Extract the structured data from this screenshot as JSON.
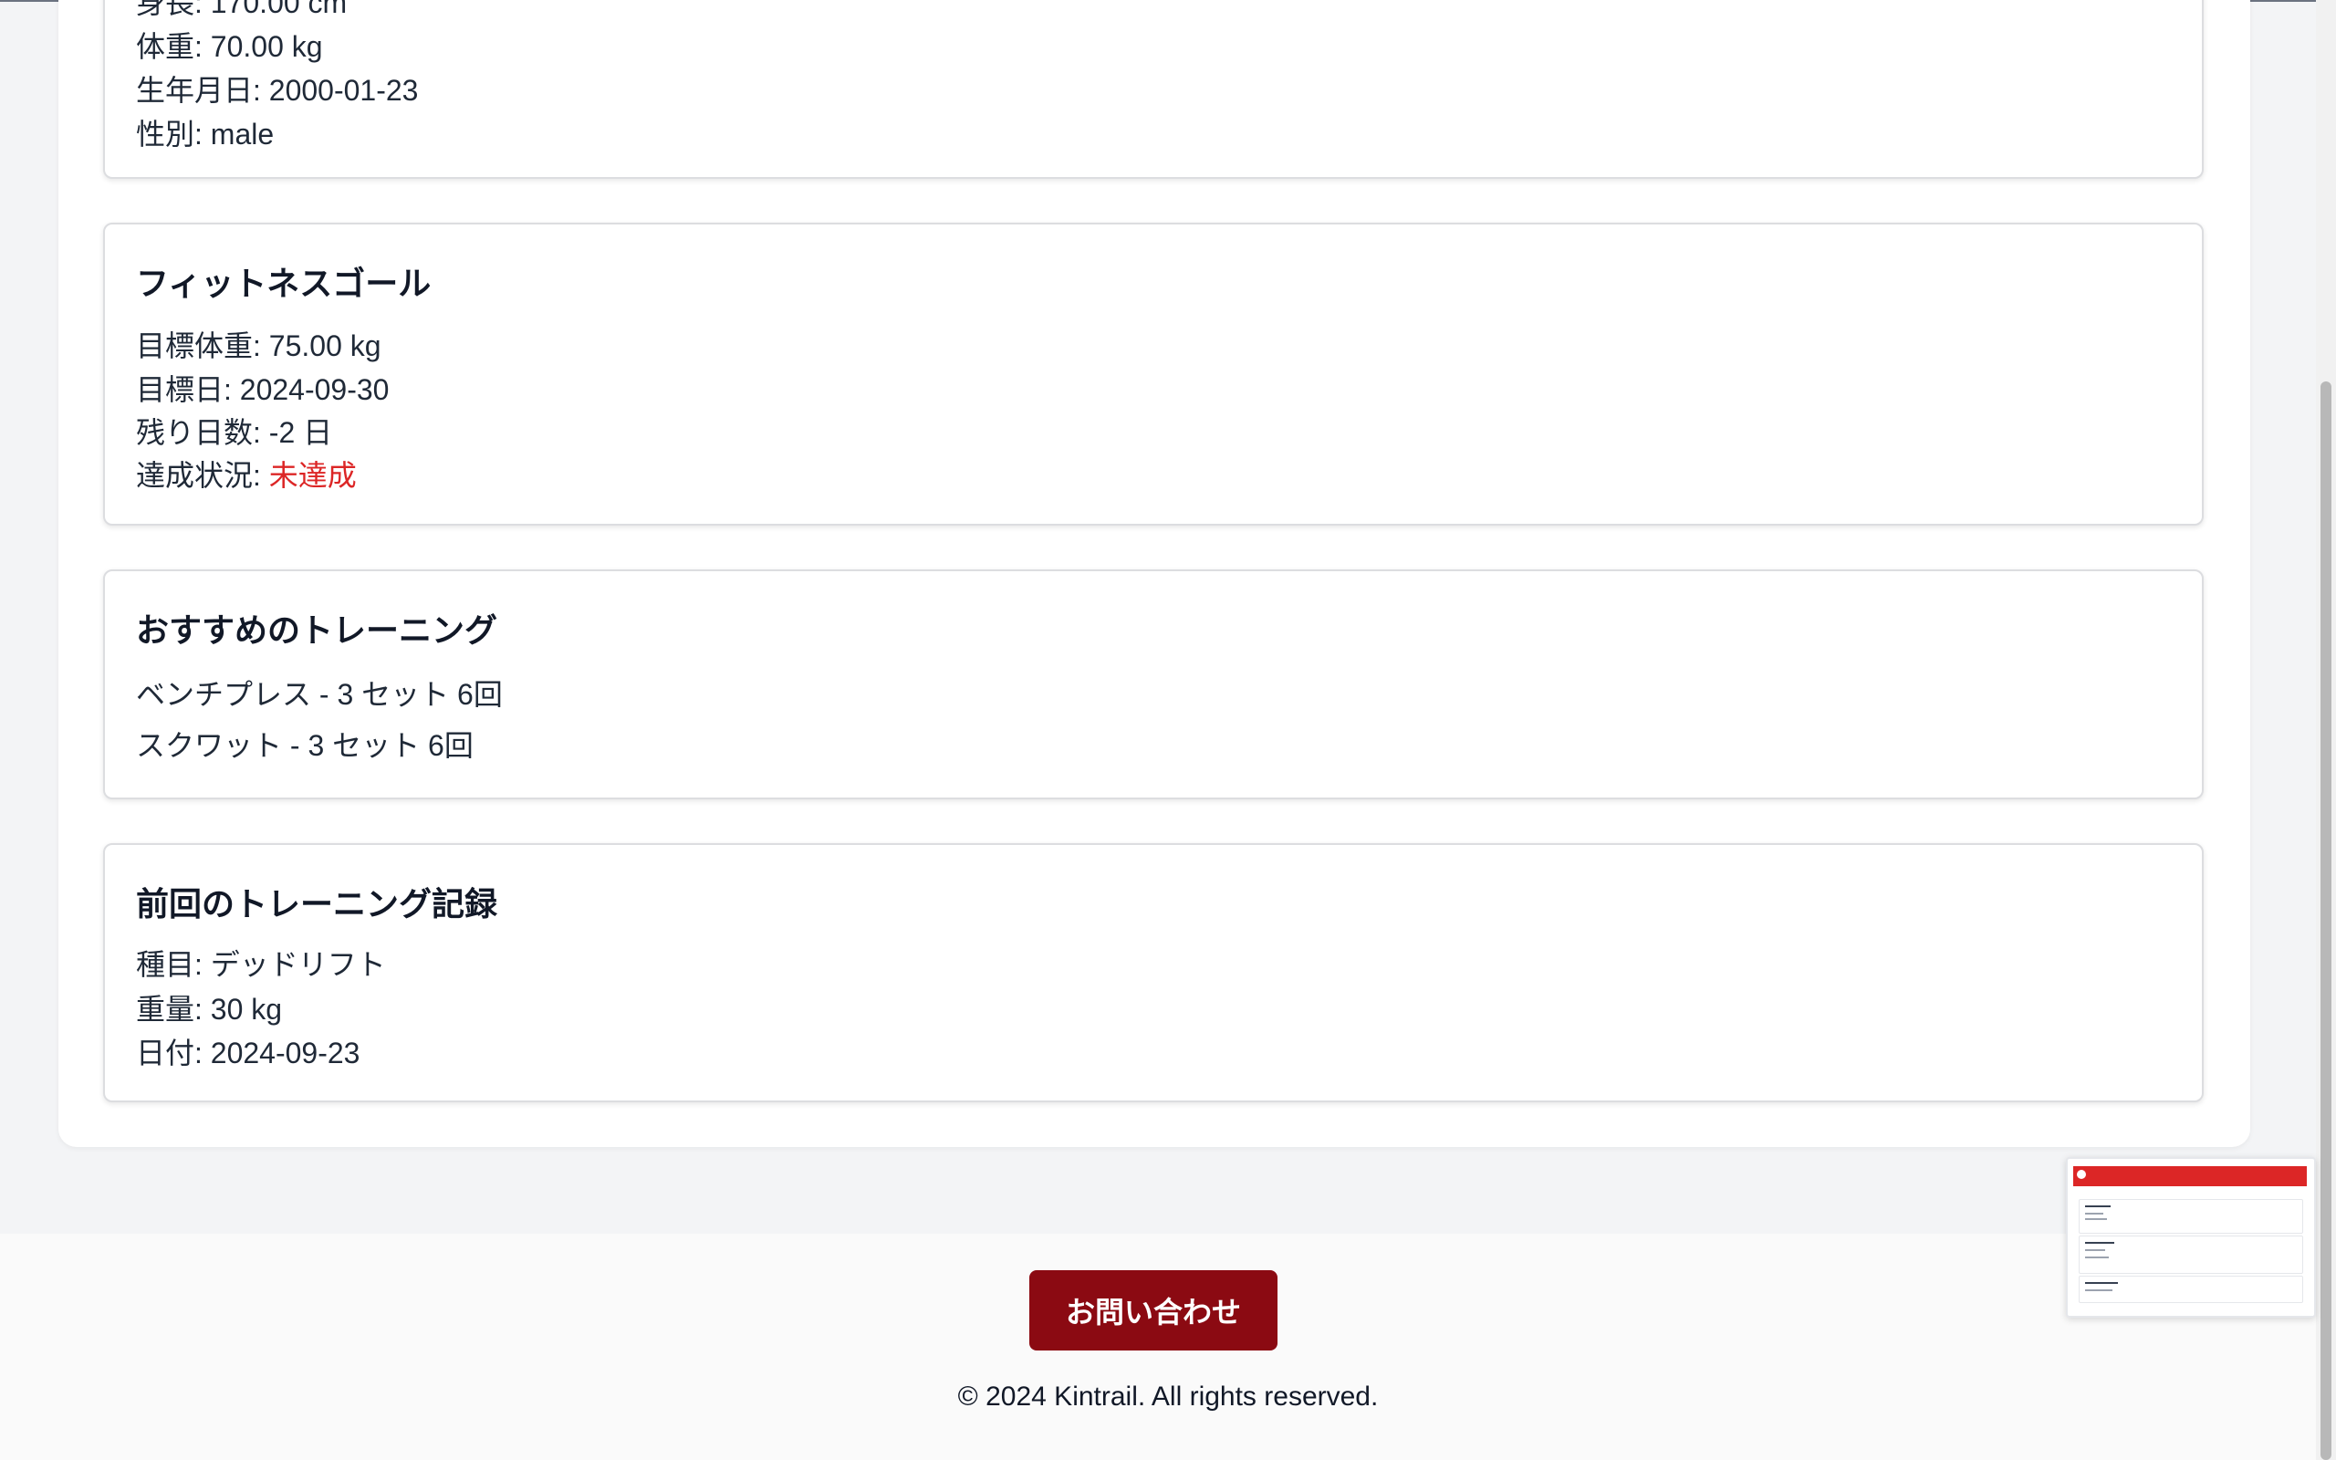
{
  "profile": {
    "partial_line": "身長: 170.00 cm",
    "weight_line": "体重: 70.00 kg",
    "birthday_line": "生年月日: 2000-01-23",
    "gender_line": "性別: male"
  },
  "goal": {
    "title": "フィットネスゴール",
    "target_weight_line": "目標体重: 75.00 kg",
    "target_date_line": "目標日: 2024-09-30",
    "days_left_line": "残り日数: -2 日",
    "status_label": "達成状況: ",
    "status_value": "未達成"
  },
  "recommended": {
    "title": "おすすめのトレーニング",
    "items": [
      "ベンチプレス - 3 セット 6回",
      "スクワット - 3 セット 6回"
    ]
  },
  "last_record": {
    "title": "前回のトレーニング記録",
    "exercise_line": "種目: デッドリフト",
    "weight_line": "重量: 30 kg",
    "date_line": "日付: 2024-09-23"
  },
  "footer": {
    "contact_label": "お問い合わせ",
    "copyright": "© 2024 Kintrail. All rights reserved."
  },
  "colors": {
    "accent": "#dc2626",
    "button": "#8b0a12"
  }
}
